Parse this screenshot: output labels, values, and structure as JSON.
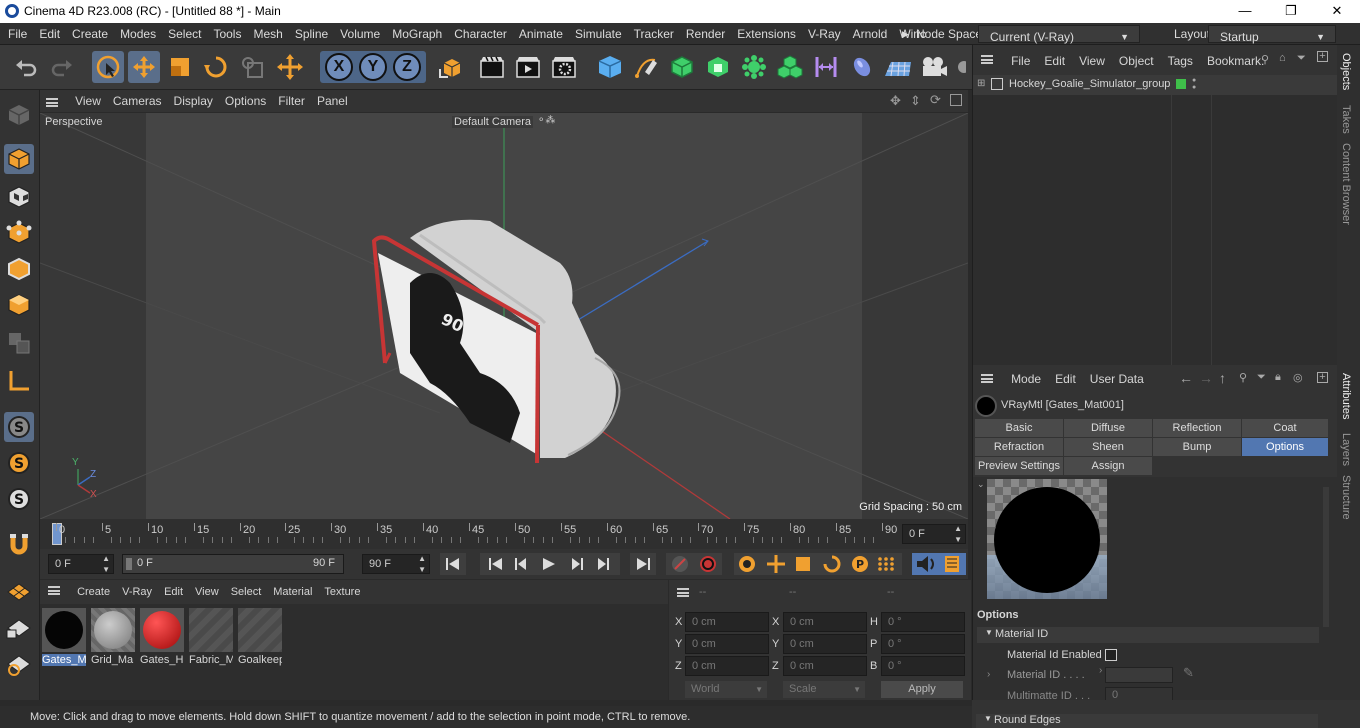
{
  "window": {
    "title": "Cinema 4D R23.008 (RC) - [Untitled 88 *] - Main",
    "minimize": "—",
    "maximize": "❐",
    "close": "✕"
  },
  "menu": [
    "File",
    "Edit",
    "Create",
    "Modes",
    "Select",
    "Tools",
    "Mesh",
    "Spline",
    "Volume",
    "MoGraph",
    "Character",
    "Animate",
    "Simulate",
    "Tracker",
    "Render",
    "Extensions",
    "V-Ray",
    "Arnold",
    "Winc"
  ],
  "node_space": {
    "label": "Node Space:",
    "value": "Current (V-Ray)"
  },
  "layout": {
    "label": "Layout:",
    "value": "Startup"
  },
  "viewport": {
    "menu": [
      "View",
      "Cameras",
      "Display",
      "Options",
      "Filter",
      "Panel"
    ],
    "projection": "Perspective",
    "camera": "Default Camera",
    "grid_spacing": "Grid Spacing : 50 cm",
    "axis_labels": {
      "y": "Y",
      "z": "Z",
      "x": "X"
    },
    "poster_number": "90"
  },
  "timeline": {
    "ticks": [
      "0",
      "5",
      "10",
      "15",
      "20",
      "25",
      "30",
      "35",
      "40",
      "45",
      "50",
      "55",
      "60",
      "65",
      "70",
      "75",
      "80",
      "85",
      "90"
    ],
    "current_frame": "0 F"
  },
  "transport": {
    "start": "0 F",
    "range_start": "0 F",
    "range_end": "90 F",
    "end": "90 F"
  },
  "material_manager": {
    "menu": [
      "Create",
      "V-Ray",
      "Edit",
      "View",
      "Select",
      "Material",
      "Texture"
    ],
    "materials": [
      {
        "name": "Gates_M",
        "kind": "black",
        "selected": true
      },
      {
        "name": "Grid_Ma",
        "kind": "grid",
        "selected": false
      },
      {
        "name": "Gates_H",
        "kind": "red",
        "selected": false
      },
      {
        "name": "Fabric_M",
        "kind": "empty",
        "selected": false
      },
      {
        "name": "Goalkeep",
        "kind": "empty",
        "selected": false
      }
    ]
  },
  "coordinates": {
    "header": [
      "--",
      "--",
      "--"
    ],
    "rows": [
      {
        "a": "X",
        "av": "0 cm",
        "b": "X",
        "bv": "0 cm",
        "c": "H",
        "cv": "0 °"
      },
      {
        "a": "Y",
        "av": "0 cm",
        "b": "Y",
        "bv": "0 cm",
        "c": "P",
        "cv": "0 °"
      },
      {
        "a": "Z",
        "av": "0 cm",
        "b": "Z",
        "bv": "0 cm",
        "c": "B",
        "cv": "0 °"
      }
    ],
    "world": "World",
    "scale": "Scale",
    "apply": "Apply"
  },
  "object_manager": {
    "menu": [
      "File",
      "Edit",
      "View",
      "Object",
      "Tags",
      "Bookmark:"
    ],
    "objects": [
      {
        "name": "Hockey_Goalie_Simulator_group"
      }
    ]
  },
  "side_tabs": {
    "top": [
      "Objects",
      "Takes",
      "Content Browser"
    ],
    "bottom": [
      "Attributes",
      "Layers",
      "Structure"
    ]
  },
  "attributes": {
    "menu": [
      "Mode",
      "Edit",
      "User Data"
    ],
    "title": "VRayMtl [Gates_Mat001]",
    "tabs_row1": [
      "Basic",
      "Diffuse",
      "Reflection",
      "Coat"
    ],
    "tabs_row2": [
      "Refraction",
      "Sheen",
      "Bump",
      "Options"
    ],
    "tabs_row3": [
      "Preview Settings",
      "Assign"
    ],
    "active_tab": "Options",
    "section": "Options",
    "group_material_id": "Material ID",
    "material_id_enabled": "Material Id Enabled",
    "material_id_label": "Material ID . . . .",
    "multimatte_label": "Multimatte ID . . .",
    "multimatte_value": "0",
    "group_round_edges": "Round Edges"
  },
  "status": "Move: Click and drag to move elements. Hold down SHIFT to quantize movement / add to the selection in point mode, CTRL to remove."
}
